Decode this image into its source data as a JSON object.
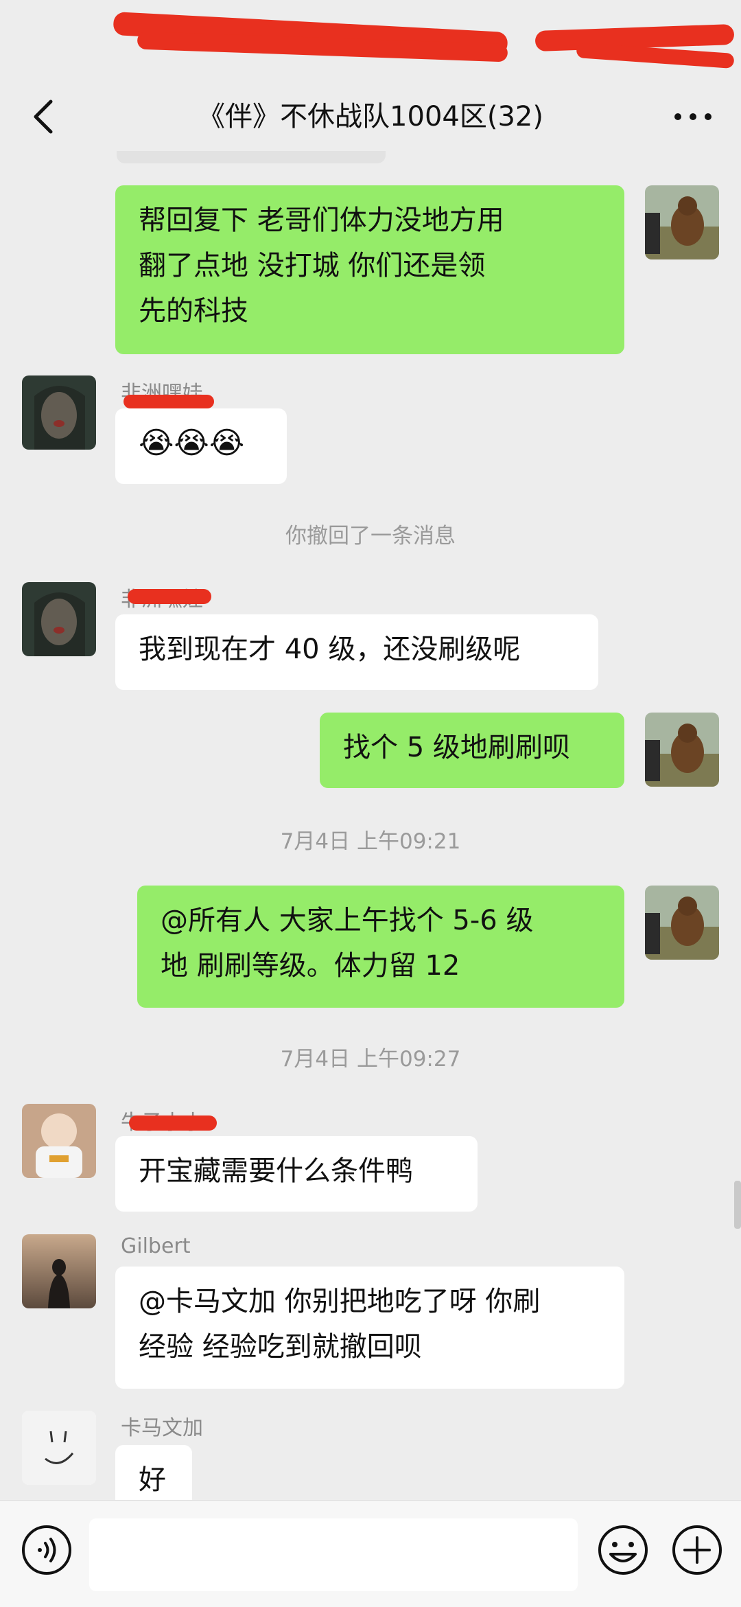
{
  "chat": {
    "title": "《伴》不休战队1004区(32)",
    "messages": [
      {
        "from": "me",
        "text_lines": [
          "帮回复下   老哥们体力没地方用",
          "翻了点地   没打城        你们还是领",
          "先的科技"
        ]
      },
      {
        "from": "feizhou",
        "sender": "非洲嘿娃",
        "emoji": "😭😭😭"
      },
      {
        "system": "你撤回了一条消息"
      },
      {
        "from": "feizhou",
        "sender": "非洲嘿娃",
        "text": "我到现在才 40 级，还没刷级呢"
      },
      {
        "from": "me",
        "text": "找个 5 级地刷刷呗"
      },
      {
        "system": "7月4日 上午09:21"
      },
      {
        "from": "me",
        "text_lines": [
          "@所有人    大家上午找个 5-6 级",
          "地 刷刷等级。体力留 12"
        ]
      },
      {
        "system": "7月4日 上午09:27"
      },
      {
        "from": "niuzi",
        "sender": "牛子小小",
        "text": "开宝藏需要什么条件鸭"
      },
      {
        "from": "gilbert",
        "sender": "Gilbert",
        "text_lines": [
          "@卡马文加    你别把地吃了呀 你刷",
          "经验 经验吃到就撤回呗"
        ]
      },
      {
        "from": "kama",
        "sender": "卡马文加",
        "text": "好"
      }
    ]
  },
  "colors": {
    "my_bubble": "#95ec69",
    "their_bubble": "#ffffff",
    "background": "#ededed",
    "redaction": "#e8301f"
  },
  "icons": {
    "back": "chevron-left-icon",
    "more": "more-dots-icon",
    "voice": "voice-icon",
    "emoji": "emoji-icon",
    "add": "plus-circle-icon"
  }
}
